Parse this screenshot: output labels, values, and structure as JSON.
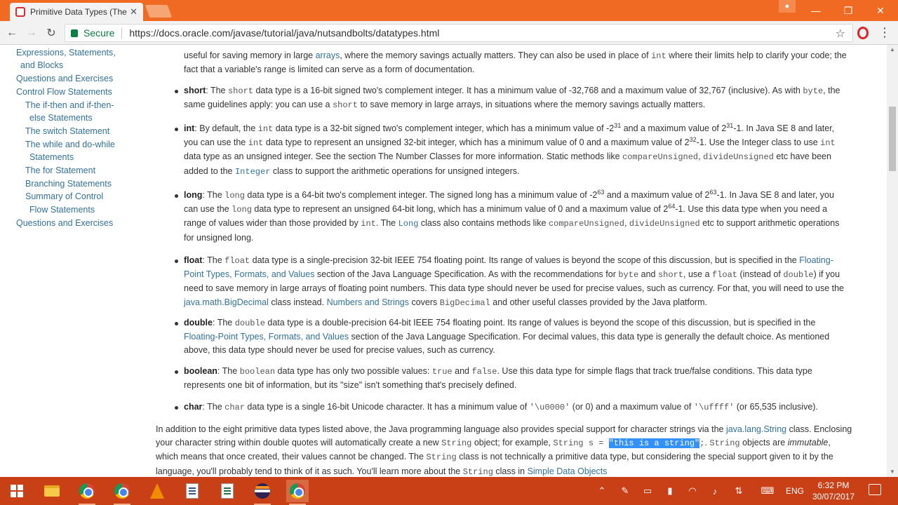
{
  "browser": {
    "tab_title": "Primitive Data Types (The",
    "tab_close": "✕",
    "secure_label": "Secure",
    "url": "https://docs.oracle.com/javase/tutorial/java/nutsandbolts/datatypes.html",
    "window_controls": {
      "minimize": "—",
      "restore": "❐",
      "close": "✕"
    },
    "user_icon": "person-icon",
    "colors": {
      "titlebar": "#f06a22",
      "secure": "#0b8043"
    }
  },
  "sidebar": {
    "items": [
      "Expressions, Statements,",
      "and Blocks",
      "Questions and Exercises",
      "Control Flow Statements",
      "The if-then and if-then-",
      "else Statements",
      "The switch Statement",
      "The while and do-while",
      "Statements",
      "The for Statement",
      "Branching Statements",
      "Summary of Control",
      "Flow Statements",
      "Questions and Exercises"
    ]
  },
  "content": {
    "byte": {
      "l1a": "useful for saving memory in large ",
      "l1link": "arrays",
      "l1b": ", where the memory savings actually matters. They can also be used in place of ",
      "l1code": "int",
      "l1c": " where their limits help to clarify your code; the",
      "l2": "fact that a variable's range is limited can serve as a form of documentation."
    },
    "short": {
      "term": "short",
      "a": ": The ",
      "code1": "short",
      "b": " data type is a 16-bit signed two's complement integer. It has a minimum value of -32,768 and a maximum value of 32,767 (inclusive). As with ",
      "code2": "byte",
      "c": ", the",
      "d": "same guidelines apply: you can use a ",
      "code3": "short",
      "e": " to save memory in large arrays, in situations where the memory savings actually matters."
    },
    "int": {
      "term": "int",
      "a": ": By default, the ",
      "code1": "int",
      "b": " data type is a 32-bit signed two's complement integer, which has a minimum value of -2",
      "sup1": "31",
      "c": " and a maximum value of 2",
      "sup2": "31",
      "d": "-1. In Java SE 8 and later,",
      "e": "you can use the ",
      "code2": "int",
      "f": " data type to represent an unsigned 32-bit integer, which has a minimum value of 0 and a maximum value of 2",
      "sup3": "32",
      "g": "-1. Use the Integer class to use ",
      "code3": "int",
      "h": "data type as an unsigned integer. See the section The Number Classes for more information. Static methods like ",
      "code4": "compareUnsigned",
      "i": ", ",
      "code5": "divideUnsigned",
      "j": " etc have been",
      "k": "added to the ",
      "code6": "Integer",
      "l": " class to support the arithmetic operations for unsigned integers."
    },
    "long": {
      "term": "long",
      "a": ": The ",
      "code1": "long",
      "b": " data type is a 64-bit two's complement integer. The signed long has a minimum value of -2",
      "sup1": "63",
      "c": " and a maximum value of 2",
      "sup2": "63",
      "d": "-1. In Java SE 8 and later, you",
      "e": "can use the ",
      "code2": "long",
      "f": " data type to represent an unsigned 64-bit long, which has a minimum value of 0 and a maximum value of 2",
      "sup3": "64",
      "g": "-1. Use this data type when you need a",
      "h": "range of values wider than those provided by ",
      "code3": "int",
      "i": ". The ",
      "code4": "Long",
      "j": " class also contains methods like ",
      "code5": "compareUnsigned",
      "k": ", ",
      "code6": "divideUnsigned",
      "l": " etc to support arithmetic operations",
      "m": "for unsigned long."
    },
    "float": {
      "term": "float",
      "a": ": The ",
      "code1": "float",
      "b": " data type is a single-precision 32-bit IEEE 754 floating point. Its range of values is beyond the scope of this discussion, but is specified in the ",
      "link1a": "Floating-",
      "link1b": "Point Types, Formats, and Values",
      "c": " section of the Java Language Specification. As with the recommendations for ",
      "code2": "byte",
      "d": " and ",
      "code3": "short",
      "e": ", use a ",
      "code4": "float",
      "f": " (instead of ",
      "code5": "double",
      "g": ") if you",
      "h": "need to save memory in large arrays of floating point numbers. This data type should never be used for precise values, such as currency. For that, you will need to use the",
      "link2": "java.math.BigDecimal",
      "i": " class instead. ",
      "link3": "Numbers and Strings",
      "j": " covers ",
      "code6": "BigDecimal",
      "k": " and other useful classes provided by the Java platform."
    },
    "double": {
      "term": "double",
      "a": ": The ",
      "code1": "double",
      "b": " data type is a double-precision 64-bit IEEE 754 floating point. Its range of values is beyond the scope of this discussion, but is specified in the",
      "link1": "Floating-Point Types, Formats, and Values",
      "c": " section of the Java Language Specification. For decimal values, this data type is generally the default choice. As mentioned",
      "d": "above, this data type should never be used for precise values, such as currency."
    },
    "boolean": {
      "term": "boolean",
      "a": ": The ",
      "code1": "boolean",
      "b": " data type has only two possible values: ",
      "code2": "true",
      "c": " and ",
      "code3": "false",
      "d": ". Use this data type for simple flags that track true/false conditions. This data type",
      "e": "represents one bit of information, but its \"size\" isn't something that's precisely defined."
    },
    "char": {
      "term": "char",
      "a": ": The ",
      "code1": "char",
      "b": " data type is a single 16-bit Unicode character. It has a minimum value of ",
      "code2": "'\\u0000'",
      "c": " (or 0) and a maximum value of ",
      "code3": "'\\uffff'",
      "d": " (or 65,535 inclusive)."
    },
    "closing": {
      "a": "In addition to the eight primitive data types listed above, the Java programming language also provides special support for character strings via the ",
      "link1": "java.lang.String",
      "b": " class. Enclosing",
      "c": "your character string within double quotes will automatically create a new ",
      "code1": "String",
      "d": " object; for example, ",
      "code2": "String s = ",
      "code3": "\"this is a string\"",
      "code4": ";",
      "e": ". ",
      "code5": "String",
      "f": " objects are ",
      "em": "immutable",
      "g": ",",
      "h": "which means that once created, their values cannot be changed. The ",
      "code6": "String",
      "i": " class is not technically a primitive data type, but considering the special support given to it by the",
      "j": "language, you'll probably tend to think of it as such. You'll learn more about the ",
      "code7": "String",
      "k": " class in ",
      "link2": "Simple Data Objects"
    }
  },
  "taskbar": {
    "apps": [
      "windows-start",
      "file-explorer",
      "chrome",
      "chrome",
      "vlc",
      "document",
      "spreadsheet",
      "eclipse",
      "chrome"
    ],
    "tray": {
      "chevron": "⌃",
      "language": "ENG"
    },
    "time": "6:32 PM",
    "date": "30/07/2017"
  }
}
